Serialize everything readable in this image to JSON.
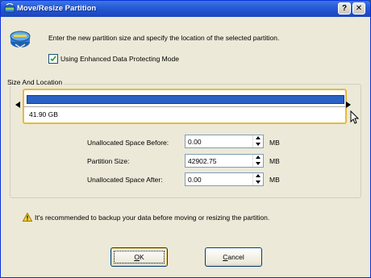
{
  "window": {
    "title": "Move/Resize Partition",
    "help_button": "?",
    "close_button": "✕"
  },
  "intro_text": "Enter the new partition size and specify the location of the selected partition.",
  "enhanced_mode": {
    "label": "Using Enhanced Data Protecting Mode",
    "checked": true
  },
  "size_and_location": {
    "group_label": "Size And Location",
    "partition_size_label": "41.90 GB",
    "partition_fill_fraction": 1.0,
    "fields": [
      {
        "label": "Unallocated Space Before:",
        "value": "0.00",
        "unit": "MB"
      },
      {
        "label": "Partition Size:",
        "value": "42902.75",
        "unit": "MB"
      },
      {
        "label": "Unallocated Space After:",
        "value": "0.00",
        "unit": "MB"
      }
    ]
  },
  "warning_text": "It's recommended to backup your data before moving or resizing the partition.",
  "buttons": {
    "ok": {
      "mnemonic": "O",
      "rest": "K"
    },
    "cancel": {
      "mnemonic": "C",
      "rest": "ancel"
    }
  },
  "colors": {
    "title_bar": "#2a5fd8",
    "partition_bar": "#2b62c4",
    "selection_border": "#e8b93a",
    "dialog_background": "#ece9d8"
  }
}
